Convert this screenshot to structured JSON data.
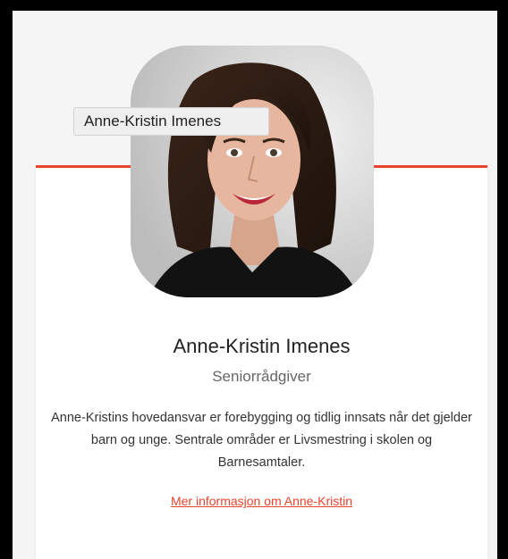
{
  "profile": {
    "name": "Anne-Kristin Imenes",
    "title": "Seniorrådgiver",
    "bio": "Anne-Kristins hovedansvar er forebygging og tidlig innsats når det gjelder barn og unge. Sentrale områder er Livsmestring i skolen og Barnesamtaler.",
    "more_link": "Mer informasjon om Anne-Kristin"
  },
  "tooltip": {
    "text": "Anne-Kristin Imenes"
  },
  "colors": {
    "accent": "#e8432d",
    "card_background": "#ffffff",
    "page_background": "#f5f5f5"
  }
}
